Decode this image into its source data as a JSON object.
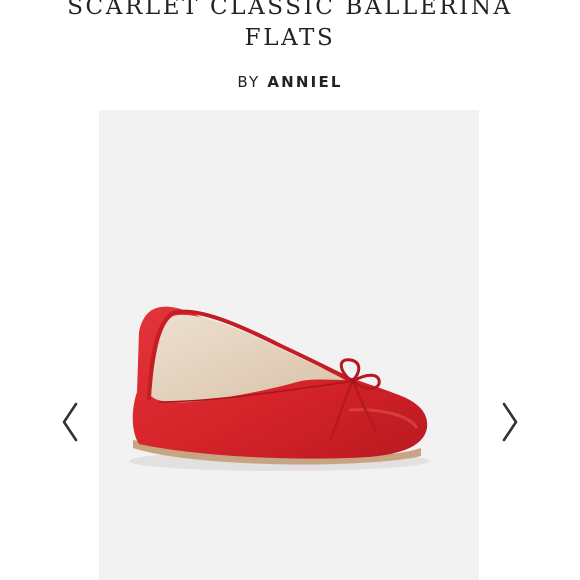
{
  "product": {
    "title_line1": "SCARLET CLASSIC BALLERINA",
    "title_line2": "FLATS",
    "by_prefix": "BY",
    "brand": "ANNIEL"
  },
  "carousel": {
    "prev_icon": "chevron-left-icon",
    "next_icon": "chevron-right-icon"
  },
  "colors": {
    "shoe_red": "#d7262b",
    "photo_background": "#f3f2f3",
    "insole": "#e6d2bd",
    "text": "#222222"
  }
}
